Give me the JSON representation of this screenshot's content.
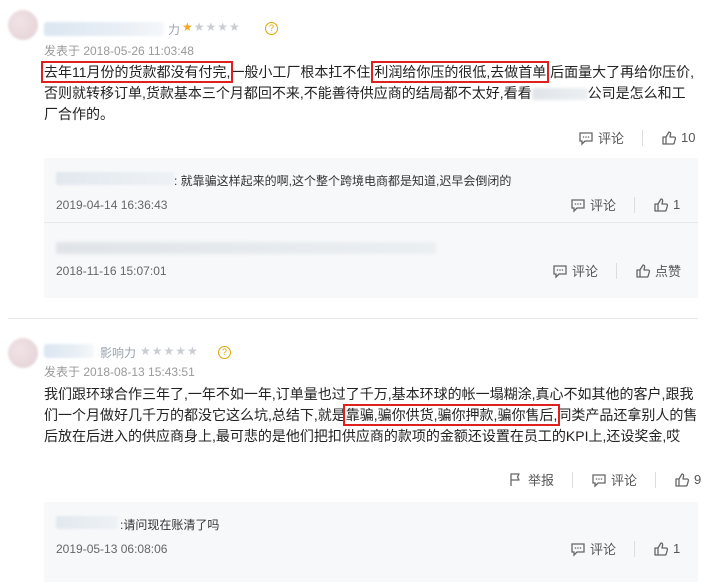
{
  "review1": {
    "influence_label": "力",
    "stars_on": "★",
    "stars_off": "★★★★",
    "posted": "发表于 2018-05-26 11:03:48",
    "text_parts": {
      "h1": "去年11月份的货款都没有付完,",
      "p1": "一般小工厂根本扛不住,",
      "h2": "利润给你压的很低,去做首单",
      "p2": ",后面量大了再给你压价,否则就转移订单,货款基本三个月都回不来,不能善待供应商的结局都不太好,看看",
      "p3": "公司是怎么和工厂合作的。"
    },
    "comment_label": "评论",
    "like_count": "10",
    "replies": [
      {
        "text": ":  就靠骗这样起来的啊,这个整个跨境电商都是知道,迟早会倒闭的",
        "date": "2019-04-14 16:36:43",
        "comment_label": "评论",
        "like_count": "1"
      },
      {
        "text": "",
        "date": "2018-11-16 15:07:01",
        "comment_label": "评论",
        "like_label": "点赞"
      }
    ]
  },
  "review2": {
    "influence_label": "影响力",
    "stars_off": "★★★★★",
    "posted": "发表于 2018-08-13 15:43:51",
    "text_parts": {
      "p1": "我们跟环球合作三年了,一年不如一年,订单量也过了千万,基本环球的帐一塌糊涂,真心不如其他的客户,跟我们一个月做好几千万的都没它这么坑,总结下,就是",
      "h1": "靠骗,骗你供货,骗你押款,骗你售后,",
      "p2": "同类产品还拿别人的售后放在后进入的供应商身上,最可悲的是他们把扣供应商的款项的金额还设置在员工的KPI上,还设奖金,哎"
    },
    "report_label": "举报",
    "comment_label": "评论",
    "like_count": "9",
    "replies": [
      {
        "text": ":请问现在账清了吗",
        "date": "2019-05-13 06:08:06",
        "comment_label": "评论",
        "like_count": "1"
      }
    ]
  }
}
